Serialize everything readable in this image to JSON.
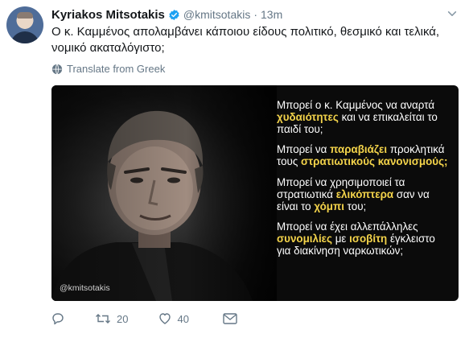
{
  "tweet": {
    "author_name": "Kyriakos Mitsotakis",
    "handle": "@kmitsotakis",
    "separator": "·",
    "time": "13m",
    "text": "Ο κ. Καμμένος απολαμβάνει κάποιου είδους πολιτικό, θεσμικό και τελικά, νομικό ακαταλόγιστο;",
    "translate_label": "Translate from Greek"
  },
  "media": {
    "watermark": "@kmitsotakis",
    "p1": {
      "a": "Μπορεί ο κ. Καμμένος να αναρτά ",
      "b": "χυδαιότητες",
      "c": " και να επικαλείται το παιδί του;"
    },
    "p2": {
      "a": "Μπορεί να ",
      "b": "παραβιάζει",
      "c": " προκλητικά τους ",
      "d": "στρατιωτικούς κανονισμούς;"
    },
    "p3": {
      "a": "Μπορεί να χρησιμοποιεί τα στρατιωτικά ",
      "b": "ελικόπτερα",
      "c": " σαν να είναι το ",
      "d": "χόμπι",
      "e": " του;"
    },
    "p4": {
      "a": "Μπορεί να έχει αλλεπάλληλες ",
      "b": "συνομιλίες",
      "c": " με ",
      "d": "ισοβίτη",
      "e": " έγκλειστο για διακίνηση ναρκωτικών;"
    }
  },
  "actions": {
    "retweet_count": "20",
    "like_count": "40"
  },
  "colors": {
    "highlight": "#f3d34a",
    "verified": "#1da1f2",
    "muted": "#657786"
  }
}
